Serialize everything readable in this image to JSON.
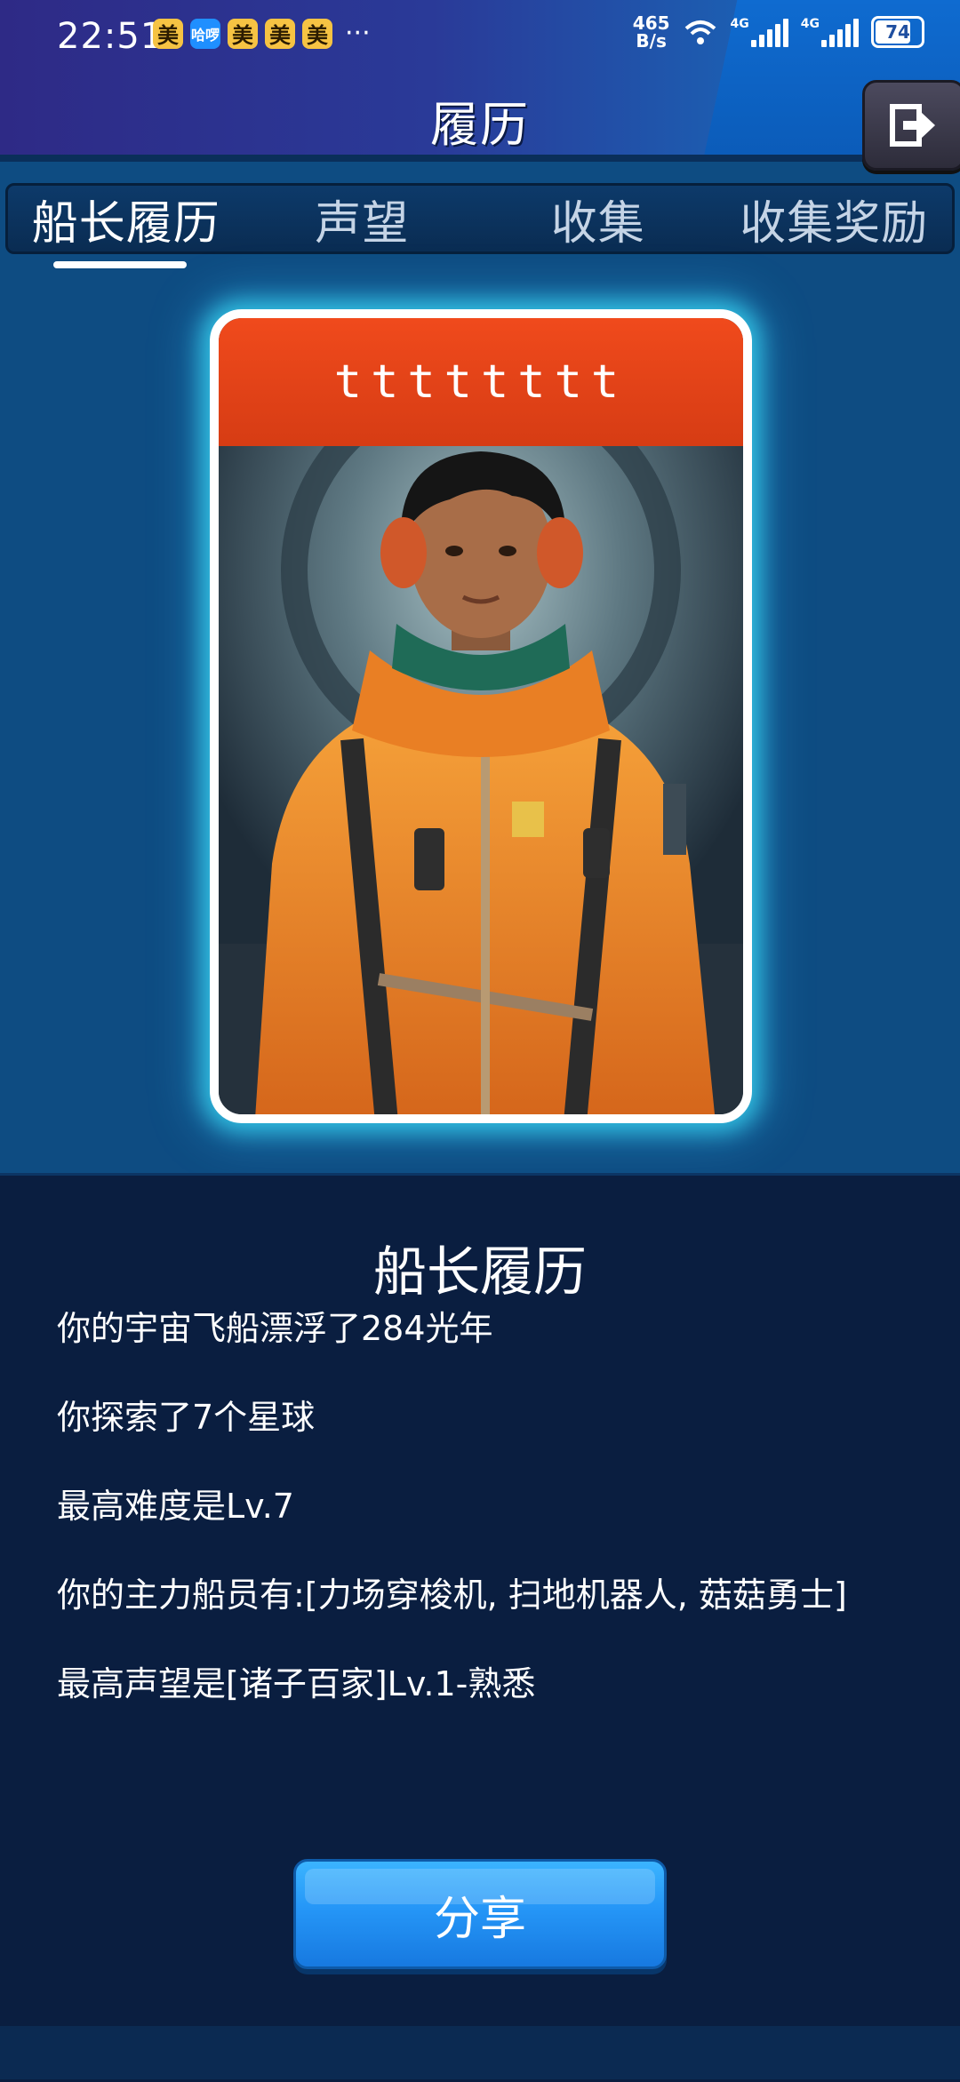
{
  "status_bar": {
    "time": "22:51",
    "notification_apps": [
      "美",
      "哈啰",
      "美",
      "美",
      "美"
    ],
    "more": "···",
    "net_speed_value": "465",
    "net_speed_unit": "B/s",
    "signal_1": "4G",
    "signal_2": "4G",
    "battery": "74"
  },
  "header": {
    "title": "履历"
  },
  "tabs": [
    {
      "label": "船长履历",
      "active": true
    },
    {
      "label": "声望",
      "active": false
    },
    {
      "label": "收集",
      "active": false
    },
    {
      "label": "收集奖励",
      "active": false
    }
  ],
  "card": {
    "name": "tttttttt"
  },
  "panel": {
    "title": "船长履历",
    "stats": [
      "你的宇宙飞船漂浮了284光年",
      "你探索了7个星球",
      "最高难度是Lv.7",
      "你的主力船员有:[力场穿梭机, 扫地机器人, 菇菇勇士]",
      "最高声望是[诸子百家]Lv.1-熟悉"
    ]
  },
  "share_button": {
    "label": "分享"
  },
  "colors": {
    "background": "#0e4c82",
    "panel": "#0a1e40",
    "card_header": "#f04a1c",
    "share_button": "#2596f7",
    "card_glow": "#3ce6ff"
  },
  "icons": {
    "exit": "exit-icon",
    "wifi": "wifi-icon",
    "battery": "battery-icon"
  }
}
